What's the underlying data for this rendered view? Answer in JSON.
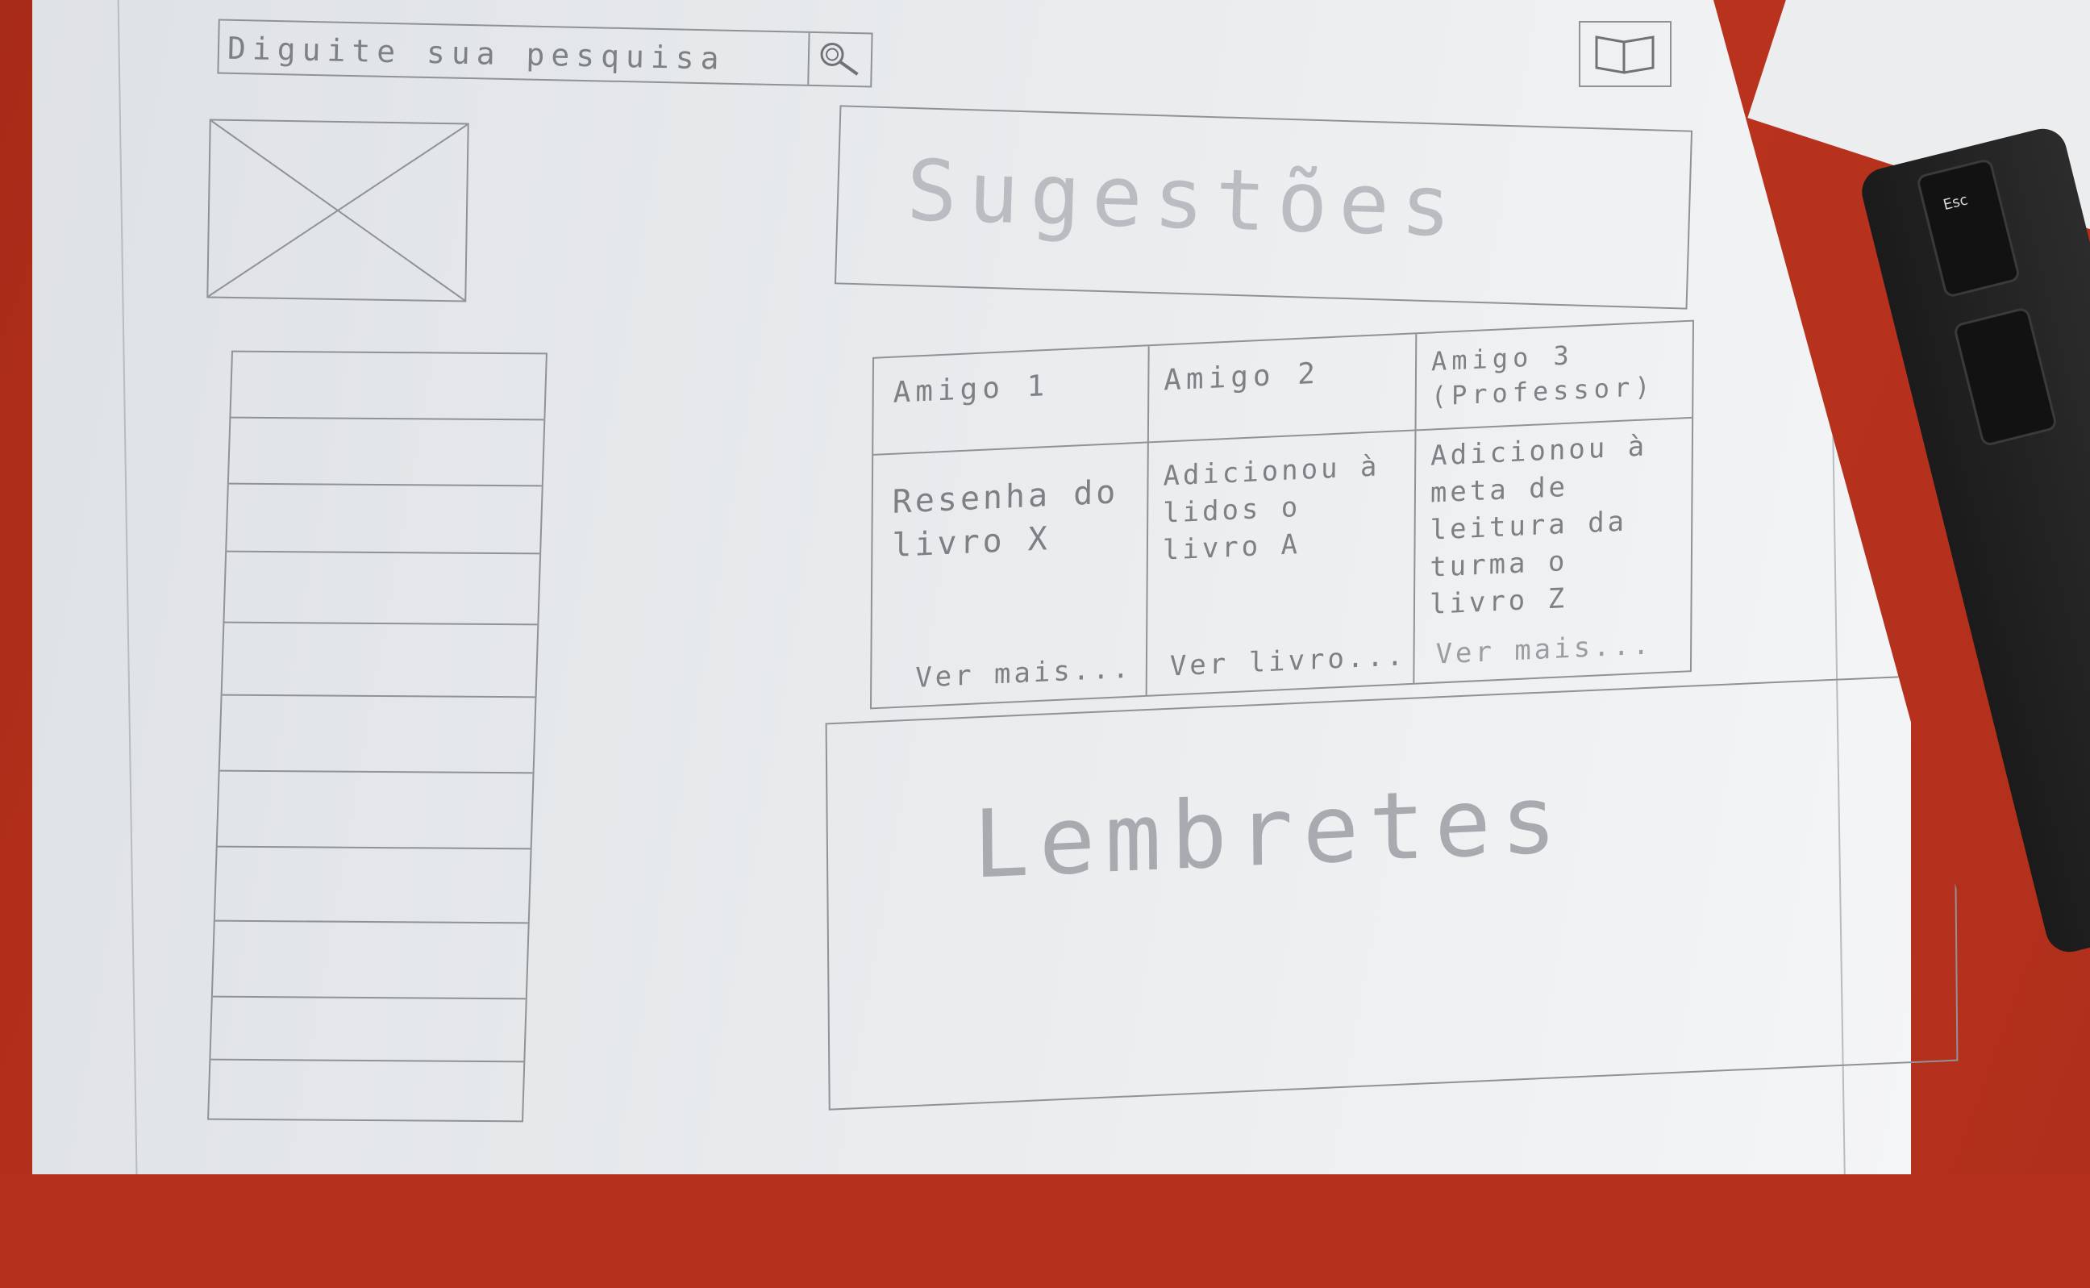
{
  "search": {
    "placeholder": "Diguite sua pesquisa",
    "button_icon": "search-icon"
  },
  "header": {
    "book_icon": "book-icon"
  },
  "sidebar": {
    "image": "image-placeholder",
    "list_rows": 10
  },
  "suggestions": {
    "title": "Sugestões"
  },
  "friends_table": {
    "columns": [
      {
        "header": "Amigo 1",
        "activity": "Resenha do\nlivro X",
        "link": "Ver mais..."
      },
      {
        "header": "Amigo 2",
        "activity": "Adicionou à\nlidos o\nlivro A",
        "link": "Ver livro..."
      },
      {
        "header": "Amigo 3\n(Professor)",
        "activity": "Adicionou à\nmeta de\nleitura da\nturma o\nlivro Z",
        "link": "Ver mais..."
      }
    ]
  },
  "reminders": {
    "title": "Lembretes"
  }
}
